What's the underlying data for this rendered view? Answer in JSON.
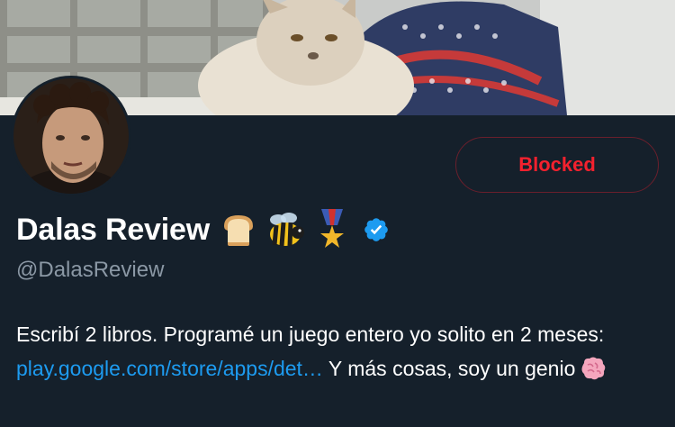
{
  "profile": {
    "display_name": "Dalas Review",
    "name_emojis": [
      "bread-emoji",
      "bee-emoji",
      "military-medal-emoji"
    ],
    "verified_icon": "verified-badge-icon",
    "handle": "@DalasReview",
    "action_button": "Blocked",
    "bio": {
      "line_text_1": "Escribí 2 libros. Programé un juego entero yo solito en 2 meses: ",
      "link": "play.google.com/store/apps/det…",
      "line_text_2": " Y más cosas, soy un genio",
      "trailing_emoji": "brain-emoji"
    }
  },
  "colors": {
    "background": "#15202b",
    "blocked_red": "#f4212e",
    "blocked_border": "#6a1f2c",
    "link_blue": "#1d9bf0",
    "handle_gray": "#8b98a5",
    "verified_blue": "#1d9bf0"
  }
}
